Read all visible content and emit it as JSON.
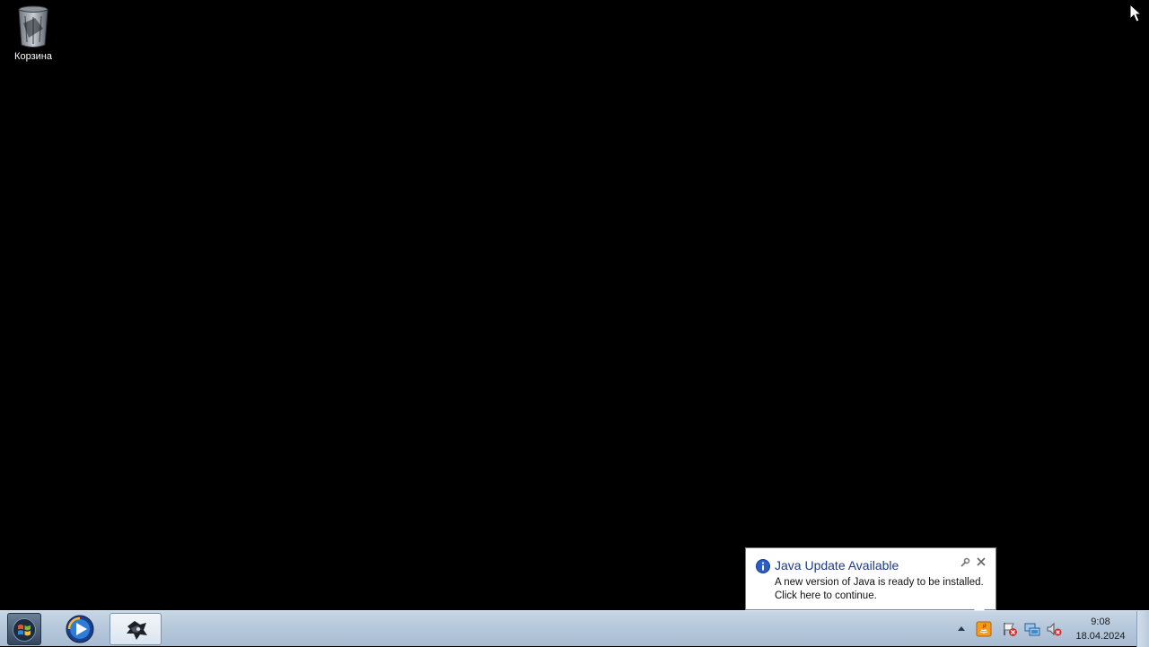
{
  "desktop": {
    "icons": [
      {
        "label": "Корзина",
        "icon": "recycle-bin-icon"
      }
    ]
  },
  "notification": {
    "title": "Java Update Available",
    "line1": "A new version of Java is ready to be installed.",
    "line2": "Click here to continue.",
    "title_color": "#1e3b8a"
  },
  "taskbar": {
    "start_icon": "windows-logo-icon",
    "pinned": [
      "windows-media-player-icon",
      "game-app-icon"
    ],
    "tray_icons": [
      "show-hidden-icons-arrow",
      "java-update-icon",
      "action-center-flag-icon",
      "network-icon",
      "volume-muted-icon"
    ],
    "clock_time": "9:08",
    "clock_date": "18.04.2024"
  }
}
